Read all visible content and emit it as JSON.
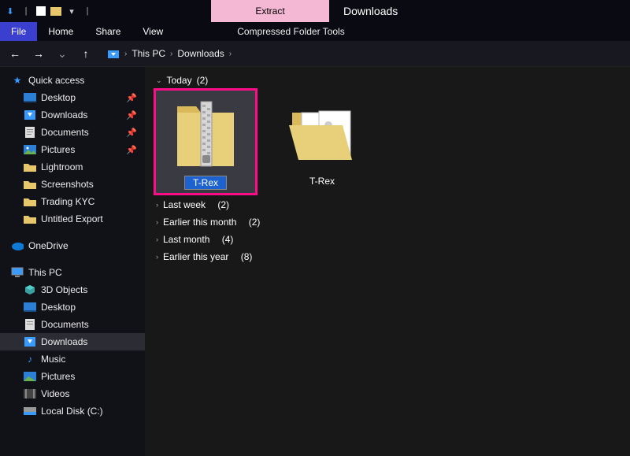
{
  "titlebar": {
    "context_tab": "Extract",
    "window_title": "Downloads"
  },
  "ribbon": {
    "file": "File",
    "home": "Home",
    "share": "Share",
    "view": "View",
    "context_tools": "Compressed Folder Tools"
  },
  "breadcrumb": {
    "root": "This PC",
    "location": "Downloads"
  },
  "sidebar": {
    "quick_access": "Quick access",
    "qa_items": [
      {
        "label": "Desktop",
        "icon": "desktop"
      },
      {
        "label": "Downloads",
        "icon": "downloads"
      },
      {
        "label": "Documents",
        "icon": "documents"
      },
      {
        "label": "Pictures",
        "icon": "pictures"
      },
      {
        "label": "Lightroom",
        "icon": "folder"
      },
      {
        "label": "Screenshots",
        "icon": "folder"
      },
      {
        "label": "Trading KYC",
        "icon": "folder"
      },
      {
        "label": "Untitled Export",
        "icon": "folder"
      }
    ],
    "onedrive": "OneDrive",
    "this_pc": "This PC",
    "pc_items": [
      {
        "label": "3D Objects",
        "icon": "3d"
      },
      {
        "label": "Desktop",
        "icon": "desktop"
      },
      {
        "label": "Documents",
        "icon": "documents"
      },
      {
        "label": "Downloads",
        "icon": "downloads",
        "selected": true
      },
      {
        "label": "Music",
        "icon": "music"
      },
      {
        "label": "Pictures",
        "icon": "pictures"
      },
      {
        "label": "Videos",
        "icon": "videos"
      },
      {
        "label": "Local Disk (C:)",
        "icon": "drive"
      }
    ]
  },
  "content": {
    "groups": {
      "today": {
        "label": "Today",
        "count": "(2)"
      },
      "last_week": {
        "label": "Last week",
        "count": "(2)"
      },
      "earlier_month": {
        "label": "Earlier this month",
        "count": "(2)"
      },
      "last_month": {
        "label": "Last month",
        "count": "(4)"
      },
      "earlier_year": {
        "label": "Earlier this year",
        "count": "(8)"
      }
    },
    "items": {
      "zip": {
        "name": "T-Rex"
      },
      "folder": {
        "name": "T-Rex"
      }
    }
  }
}
